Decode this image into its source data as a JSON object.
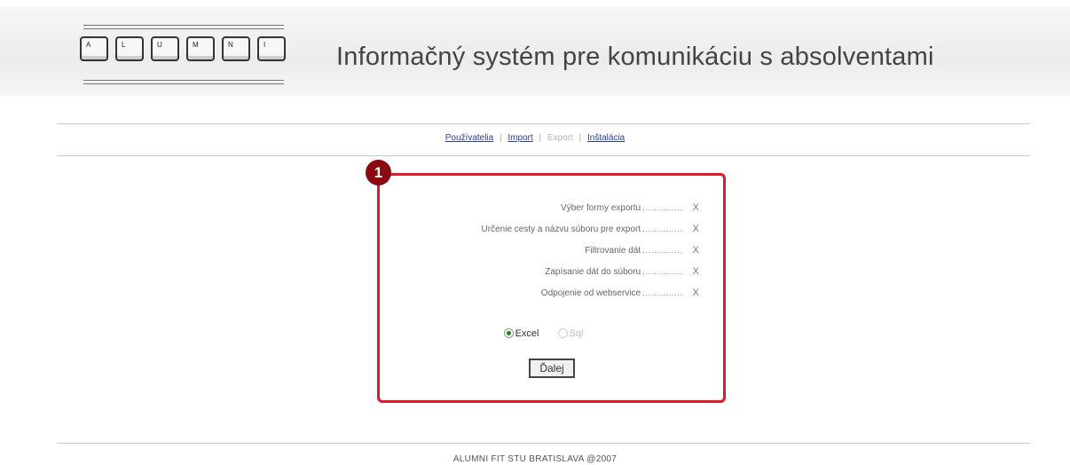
{
  "header": {
    "logo_letters": [
      "A",
      "L",
      "U",
      "M",
      "N",
      "I"
    ],
    "title": "Informačný systém pre komunikáciu s absolventami"
  },
  "nav": {
    "items": [
      {
        "label": "Používatelia",
        "state": "link"
      },
      {
        "label": "Import",
        "state": "link"
      },
      {
        "label": "Export",
        "state": "current"
      },
      {
        "label": "Inštalácia",
        "state": "link"
      }
    ],
    "separator": "|"
  },
  "panel": {
    "badge": "1",
    "steps": [
      {
        "label": "Výber formy exportu",
        "status": "X"
      },
      {
        "label": "Určenie cesty a názvu súboru pre export",
        "status": "X"
      },
      {
        "label": "Filtrovanie dát",
        "status": "X"
      },
      {
        "label": "Zapísanie dát do súboru",
        "status": "X"
      },
      {
        "label": "Odpojenie od webservice",
        "status": "X"
      }
    ],
    "dots": "..............",
    "formats": [
      {
        "label": "Excel",
        "selected": true,
        "enabled": true
      },
      {
        "label": "Sql",
        "selected": false,
        "enabled": false
      }
    ],
    "next_button": "Ďalej"
  },
  "footer": {
    "text": "ALUMNI FIT STU BRATISLAVA @2007"
  },
  "colors": {
    "highlight_border": "#e0182c",
    "badge_bg": "#8a0a12",
    "link": "#2a3c9c"
  }
}
